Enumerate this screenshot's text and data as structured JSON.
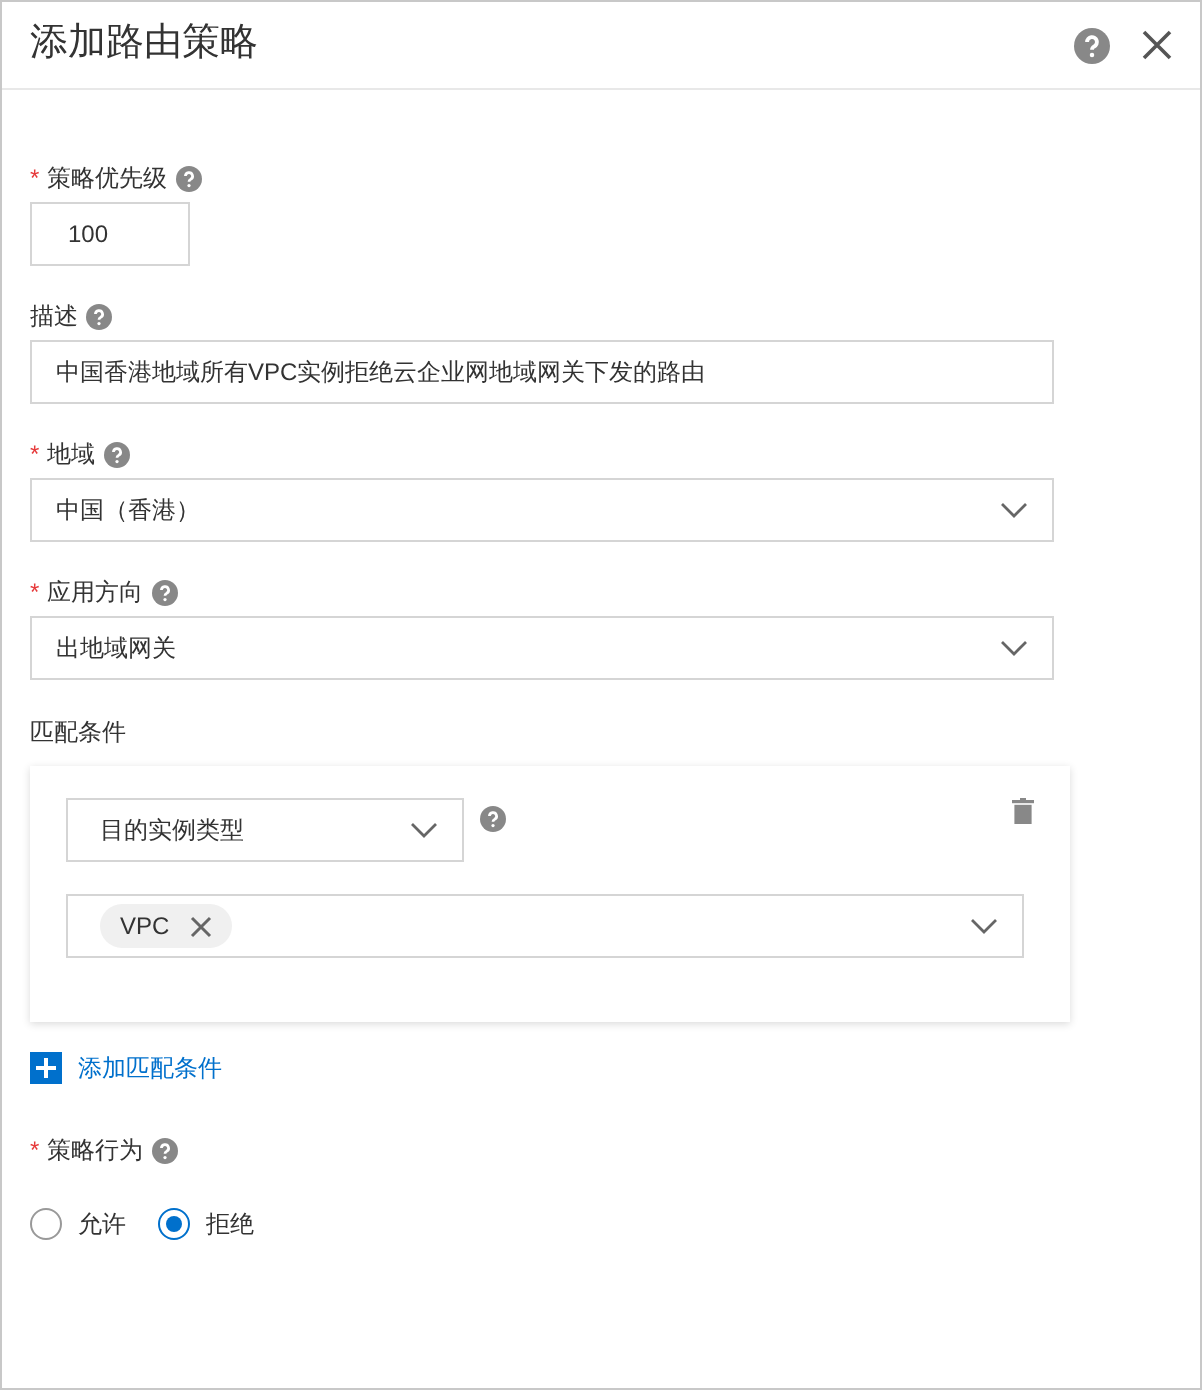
{
  "dialog": {
    "title": "添加路由策略"
  },
  "fields": [
    {
      "label": "策略优先级",
      "required_mark": "*",
      "help": true,
      "kind": "input",
      "value": "100",
      "narrow": true
    },
    {
      "label": "描述",
      "help": true,
      "kind": "input",
      "value": "中国香港地域所有VPC实例拒绝云企业网地域网关下发的路由",
      "narrow": false
    },
    {
      "label": "地域",
      "required_mark": "*",
      "help": true,
      "kind": "select",
      "value": "中国（香港）",
      "narrow": false
    },
    {
      "label": "应用方向",
      "required_mark": "*",
      "help": true,
      "kind": "select",
      "value": "出地域网关",
      "narrow": false
    }
  ],
  "match_conditions": {
    "label": "匹配条件",
    "conditions": [
      {
        "type": "目的实例类型",
        "tags": [
          "VPC"
        ]
      }
    ],
    "add_link": "添加匹配条件"
  },
  "action": {
    "label": "策略行为",
    "required_mark": "*",
    "help": true,
    "options": [
      {
        "label": "允许",
        "selected": false
      },
      {
        "label": "拒绝",
        "selected": true
      }
    ]
  }
}
